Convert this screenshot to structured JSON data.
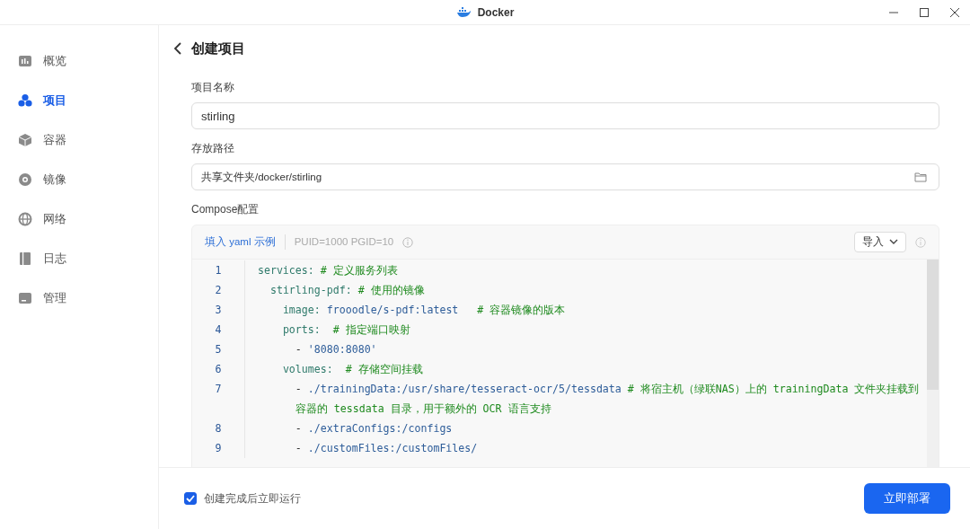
{
  "window": {
    "title": "Docker"
  },
  "sidebar": {
    "items": [
      {
        "label": "概览",
        "selected": false
      },
      {
        "label": "项目",
        "selected": true
      },
      {
        "label": "容器",
        "selected": false
      },
      {
        "label": "镜像",
        "selected": false
      },
      {
        "label": "网络",
        "selected": false
      },
      {
        "label": "日志",
        "selected": false
      },
      {
        "label": "管理",
        "selected": false
      }
    ]
  },
  "page": {
    "title": "创建项目"
  },
  "form": {
    "name_label": "项目名称",
    "name_value": "stirling",
    "path_label": "存放路径",
    "path_value": "共享文件夹/docker/stirling",
    "compose_label": "Compose配置"
  },
  "editor": {
    "example_link": "填入 yaml 示例",
    "hint": "PUID=1000 PGID=10",
    "import_button": "导入",
    "lines": [
      {
        "number": "1",
        "segments": [
          {
            "kind": "key",
            "text": "services:"
          },
          {
            "kind": "comment",
            "text": " # 定义服务列表"
          }
        ]
      },
      {
        "number": "2",
        "segments": [
          {
            "kind": "key",
            "text": "  stirling-pdf:"
          },
          {
            "kind": "comment",
            "text": " # 使用的镜像"
          }
        ]
      },
      {
        "number": "3",
        "segments": [
          {
            "kind": "key",
            "text": "    image: "
          },
          {
            "kind": "string",
            "text": "frooodle/s-pdf:latest"
          },
          {
            "kind": "comment",
            "text": "   # 容器镜像的版本"
          }
        ]
      },
      {
        "number": "4",
        "segments": [
          {
            "kind": "key",
            "text": "    ports:"
          },
          {
            "kind": "comment",
            "text": "  # 指定端口映射"
          }
        ]
      },
      {
        "number": "5",
        "segments": [
          {
            "kind": "plain",
            "text": "      - "
          },
          {
            "kind": "string",
            "text": "'8080:8080'"
          }
        ]
      },
      {
        "number": "6",
        "segments": [
          {
            "kind": "key",
            "text": "    volumes:"
          },
          {
            "kind": "comment",
            "text": "  # 存储空间挂载"
          }
        ]
      },
      {
        "number": "7",
        "segments": [
          {
            "kind": "plain",
            "text": "      - "
          },
          {
            "kind": "string",
            "text": "./trainingData:/usr/share/tesseract-ocr/5/tessdata"
          },
          {
            "kind": "comment",
            "text": " # 将宿主机（绿联NAS）上的 trainingData 文件夹挂载到容器的 tessdata 目录，用于额外的 OCR 语言支持"
          }
        ]
      },
      {
        "number": "8",
        "segments": [
          {
            "kind": "plain",
            "text": "      - "
          },
          {
            "kind": "string",
            "text": "./extraConfigs:/configs"
          }
        ]
      },
      {
        "number": "9",
        "segments": [
          {
            "kind": "plain",
            "text": "      - "
          },
          {
            "kind": "string",
            "text": "./customFiles:/customFiles/"
          }
        ]
      }
    ]
  },
  "footer": {
    "run_after_create": {
      "label": "创建完成后立即运行",
      "checked": true
    },
    "deploy_button": "立即部署"
  }
}
